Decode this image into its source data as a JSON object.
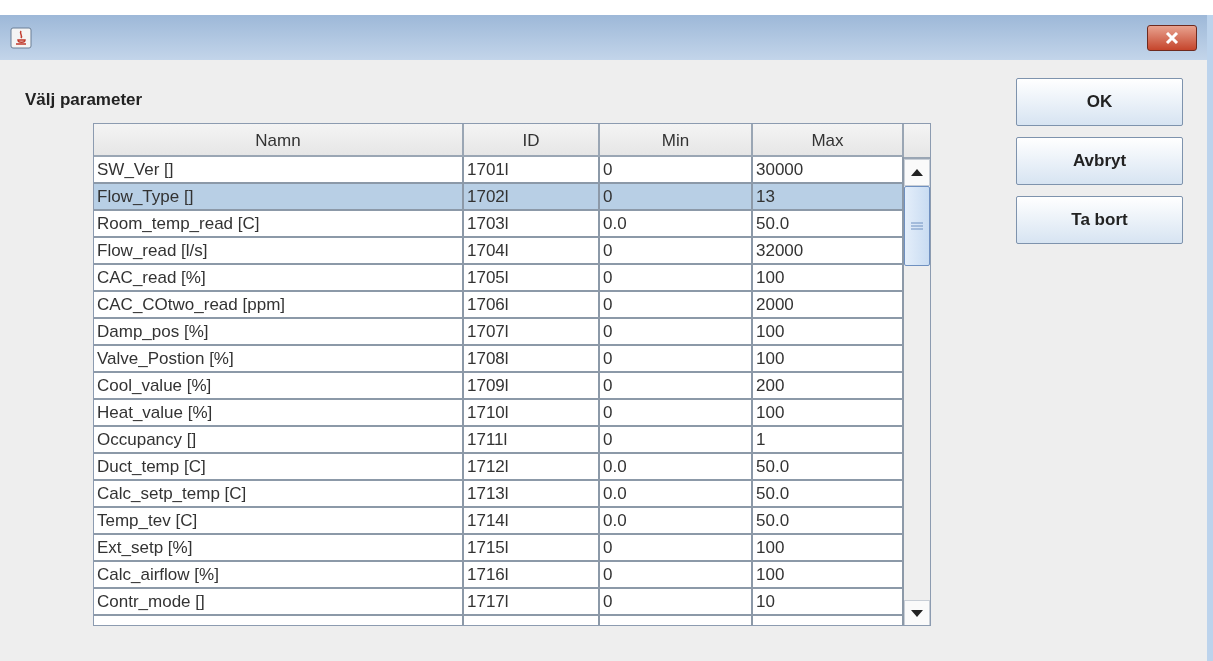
{
  "heading": "Välj parameter",
  "table": {
    "columns": [
      "Namn",
      "ID",
      "Min",
      "Max"
    ],
    "rows": [
      {
        "cells": [
          "SW_Ver []",
          "1701l",
          "0",
          "30000"
        ],
        "selected": false
      },
      {
        "cells": [
          "Flow_Type []",
          "1702l",
          "0",
          "13"
        ],
        "selected": true
      },
      {
        "cells": [
          "Room_temp_read [C]",
          "1703l",
          "0.0",
          "50.0"
        ],
        "selected": false
      },
      {
        "cells": [
          "Flow_read [l/s]",
          "1704l",
          "0",
          "32000"
        ],
        "selected": false
      },
      {
        "cells": [
          "CAC_read [%]",
          "1705l",
          "0",
          "100"
        ],
        "selected": false
      },
      {
        "cells": [
          "CAC_COtwo_read [ppm]",
          "1706l",
          "0",
          "2000"
        ],
        "selected": false
      },
      {
        "cells": [
          "Damp_pos [%]",
          "1707l",
          "0",
          "100"
        ],
        "selected": false
      },
      {
        "cells": [
          "Valve_Postion [%]",
          "1708l",
          "0",
          "100"
        ],
        "selected": false
      },
      {
        "cells": [
          "Cool_value [%]",
          "1709l",
          "0",
          "200"
        ],
        "selected": false
      },
      {
        "cells": [
          "Heat_value [%]",
          "1710l",
          "0",
          "100"
        ],
        "selected": false
      },
      {
        "cells": [
          "Occupancy []",
          "1711l",
          "0",
          "1"
        ],
        "selected": false
      },
      {
        "cells": [
          "Duct_temp [C]",
          "1712l",
          "0.0",
          "50.0"
        ],
        "selected": false
      },
      {
        "cells": [
          "Calc_setp_temp [C]",
          "1713l",
          "0.0",
          "50.0"
        ],
        "selected": false
      },
      {
        "cells": [
          "Temp_tev [C]",
          "1714l",
          "0.0",
          "50.0"
        ],
        "selected": false
      },
      {
        "cells": [
          "Ext_setp [%]",
          "1715l",
          "0",
          "100"
        ],
        "selected": false
      },
      {
        "cells": [
          "Calc_airflow [%]",
          "1716l",
          "0",
          "100"
        ],
        "selected": false
      },
      {
        "cells": [
          "Contr_mode []",
          "1717l",
          "0",
          "10"
        ],
        "selected": false
      }
    ]
  },
  "buttons": [
    "OK",
    "Avbryt",
    "Ta bort"
  ]
}
